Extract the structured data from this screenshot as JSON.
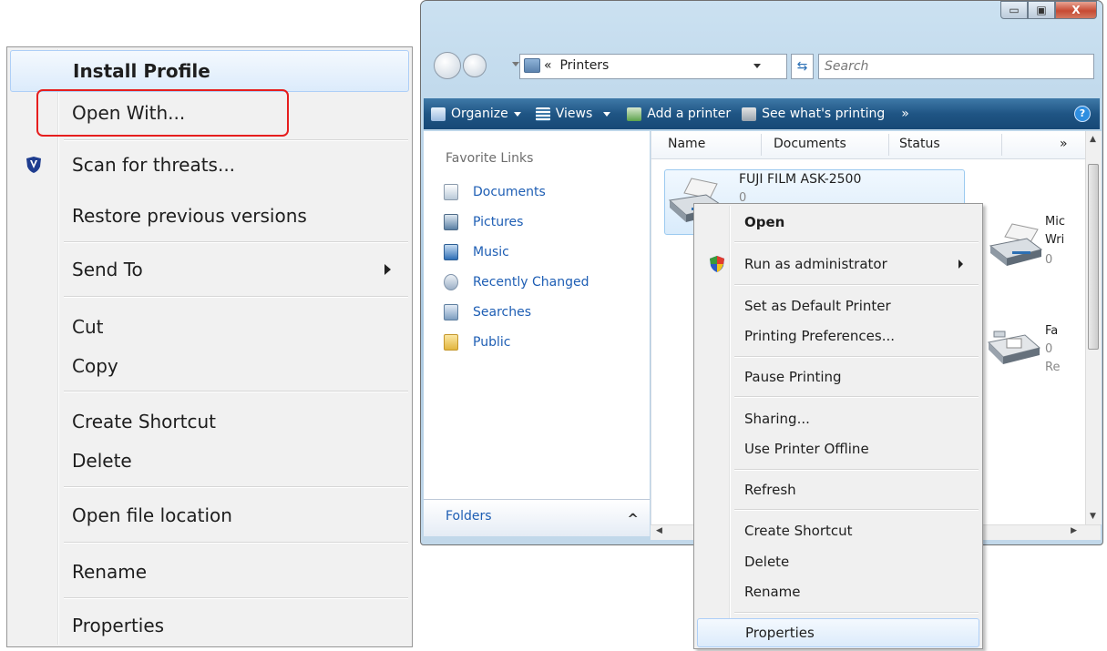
{
  "left_menu": {
    "items": [
      {
        "label": "Install Profile",
        "bold": true,
        "highlighted": true
      },
      {
        "label": "Open With...",
        "boxed": true
      },
      {
        "label": "Scan for threats...",
        "icon": "shield-v-icon"
      },
      {
        "label": "Restore previous versions"
      },
      {
        "label": "Send To",
        "submenu": true
      },
      {
        "label": "Cut"
      },
      {
        "label": "Copy"
      },
      {
        "label": "Create Shortcut"
      },
      {
        "label": "Delete"
      },
      {
        "label": "Open file location"
      },
      {
        "label": "Rename"
      },
      {
        "label": "Properties"
      }
    ]
  },
  "window": {
    "caption_buttons": {
      "minimize": "▭",
      "maximize": "▣",
      "close": "X"
    },
    "address": {
      "chevron": "«",
      "text": "Printers"
    },
    "search": {
      "placeholder": "Search"
    },
    "toolbar": {
      "organize": "Organize",
      "views": "Views",
      "add_printer": "Add a printer",
      "see_printing": "See what's printing",
      "more": "»",
      "help": "?"
    },
    "nav": {
      "title": "Favorite Links",
      "links": [
        "Documents",
        "Pictures",
        "Music",
        "Recently Changed",
        "Searches",
        "Public"
      ],
      "folders_label": "Folders",
      "folders_chevron": "^"
    },
    "columns": {
      "name": "Name",
      "documents": "Documents",
      "status": "Status",
      "more": "»"
    },
    "printers": [
      {
        "name": "FUJI FILM ASK-2500",
        "count": "0",
        "selected": true
      },
      {
        "name": "Mic",
        "line2": "Wri",
        "count": "0"
      },
      {
        "name": "Fa",
        "count": "0",
        "status": "Re"
      }
    ]
  },
  "context_menu": {
    "items": [
      {
        "label": "Open",
        "bold": true
      },
      {
        "label": "Run as administrator",
        "icon": "uac-shield-icon",
        "submenu": true
      },
      {
        "label": "Set as Default Printer"
      },
      {
        "label": "Printing Preferences..."
      },
      {
        "label": "Pause Printing"
      },
      {
        "label": "Sharing..."
      },
      {
        "label": "Use Printer Offline"
      },
      {
        "label": "Refresh"
      },
      {
        "label": "Create Shortcut"
      },
      {
        "label": "Delete"
      },
      {
        "label": "Rename"
      },
      {
        "label": "Properties",
        "highlighted": true
      }
    ]
  },
  "colors": {
    "highlight_border": "#aecff7",
    "red_box": "#e61e1e",
    "toolbar": "#1f5584",
    "link": "#1e5eb4"
  }
}
